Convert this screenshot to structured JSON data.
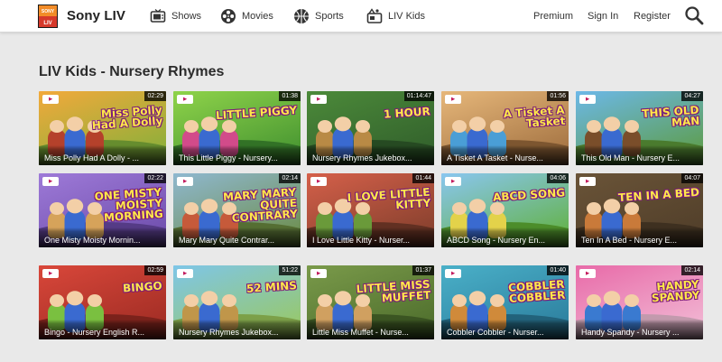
{
  "header": {
    "brand": "Sony LIV",
    "logo_text": "SONY LIV",
    "nav": [
      {
        "label": "Shows",
        "icon": "tv-icon"
      },
      {
        "label": "Movies",
        "icon": "film-reel-icon"
      },
      {
        "label": "Sports",
        "icon": "ball-icon"
      },
      {
        "label": "LIV Kids",
        "icon": "kids-icon"
      }
    ],
    "right": [
      {
        "label": "Premium"
      },
      {
        "label": "Sign In"
      },
      {
        "label": "Register"
      }
    ],
    "search_icon": "search-icon"
  },
  "section": {
    "title": "LIV Kids - Nursery Rhymes"
  },
  "colors": {
    "accent": "#f28c28",
    "caption_text": "#ffffff",
    "background": "#e9e9e9"
  },
  "videos": [
    {
      "duration": "02:29",
      "title": "Miss Polly Had A Dolly - ...",
      "art": "Miss Polly Had A Dolly"
    },
    {
      "duration": "01:38",
      "title": "This Little Piggy - Nursery...",
      "art": "LITTLE PIGGY"
    },
    {
      "duration": "01:14:47",
      "title": "Nursery Rhymes Jukebox...",
      "art": "1 HOUR"
    },
    {
      "duration": "01:56",
      "title": "A Tisket A Tasket - Nurse...",
      "art": "A Tisket A Tasket"
    },
    {
      "duration": "04:27",
      "title": "This Old Man - Nursery E...",
      "art": "THIS OLD MAN"
    },
    {
      "duration": "02:22",
      "title": "One Misty Moisty Mornin...",
      "art": "ONE MISTY MOISTY MORNING"
    },
    {
      "duration": "02:14",
      "title": "Mary Mary Quite Contrar...",
      "art": "MARY MARY QUITE CONTRARY"
    },
    {
      "duration": "01:44",
      "title": "I Love Little Kitty - Nurser...",
      "art": "I LOVE LITTLE KITTY"
    },
    {
      "duration": "04:06",
      "title": "ABCD Song - Nursery En...",
      "art": "ABCD SONG"
    },
    {
      "duration": "04:07",
      "title": "Ten In A Bed - Nursery E...",
      "art": "TEN IN A BED"
    },
    {
      "duration": "02:59",
      "title": "Bingo - Nursery English R...",
      "art": "BINGO"
    },
    {
      "duration": "51:22",
      "title": "Nursery Rhymes Jukebox...",
      "art": "52 MINS"
    },
    {
      "duration": "01:37",
      "title": "Little Miss Muffet - Nurse...",
      "art": "LITTLE MISS MUFFET"
    },
    {
      "duration": "01:40",
      "title": "Cobbler Cobbler - Nurser...",
      "art": "COBBLER COBBLER"
    },
    {
      "duration": "02:14",
      "title": "Handy Spandy - Nursery ...",
      "art": "HANDY SPANDY"
    }
  ]
}
